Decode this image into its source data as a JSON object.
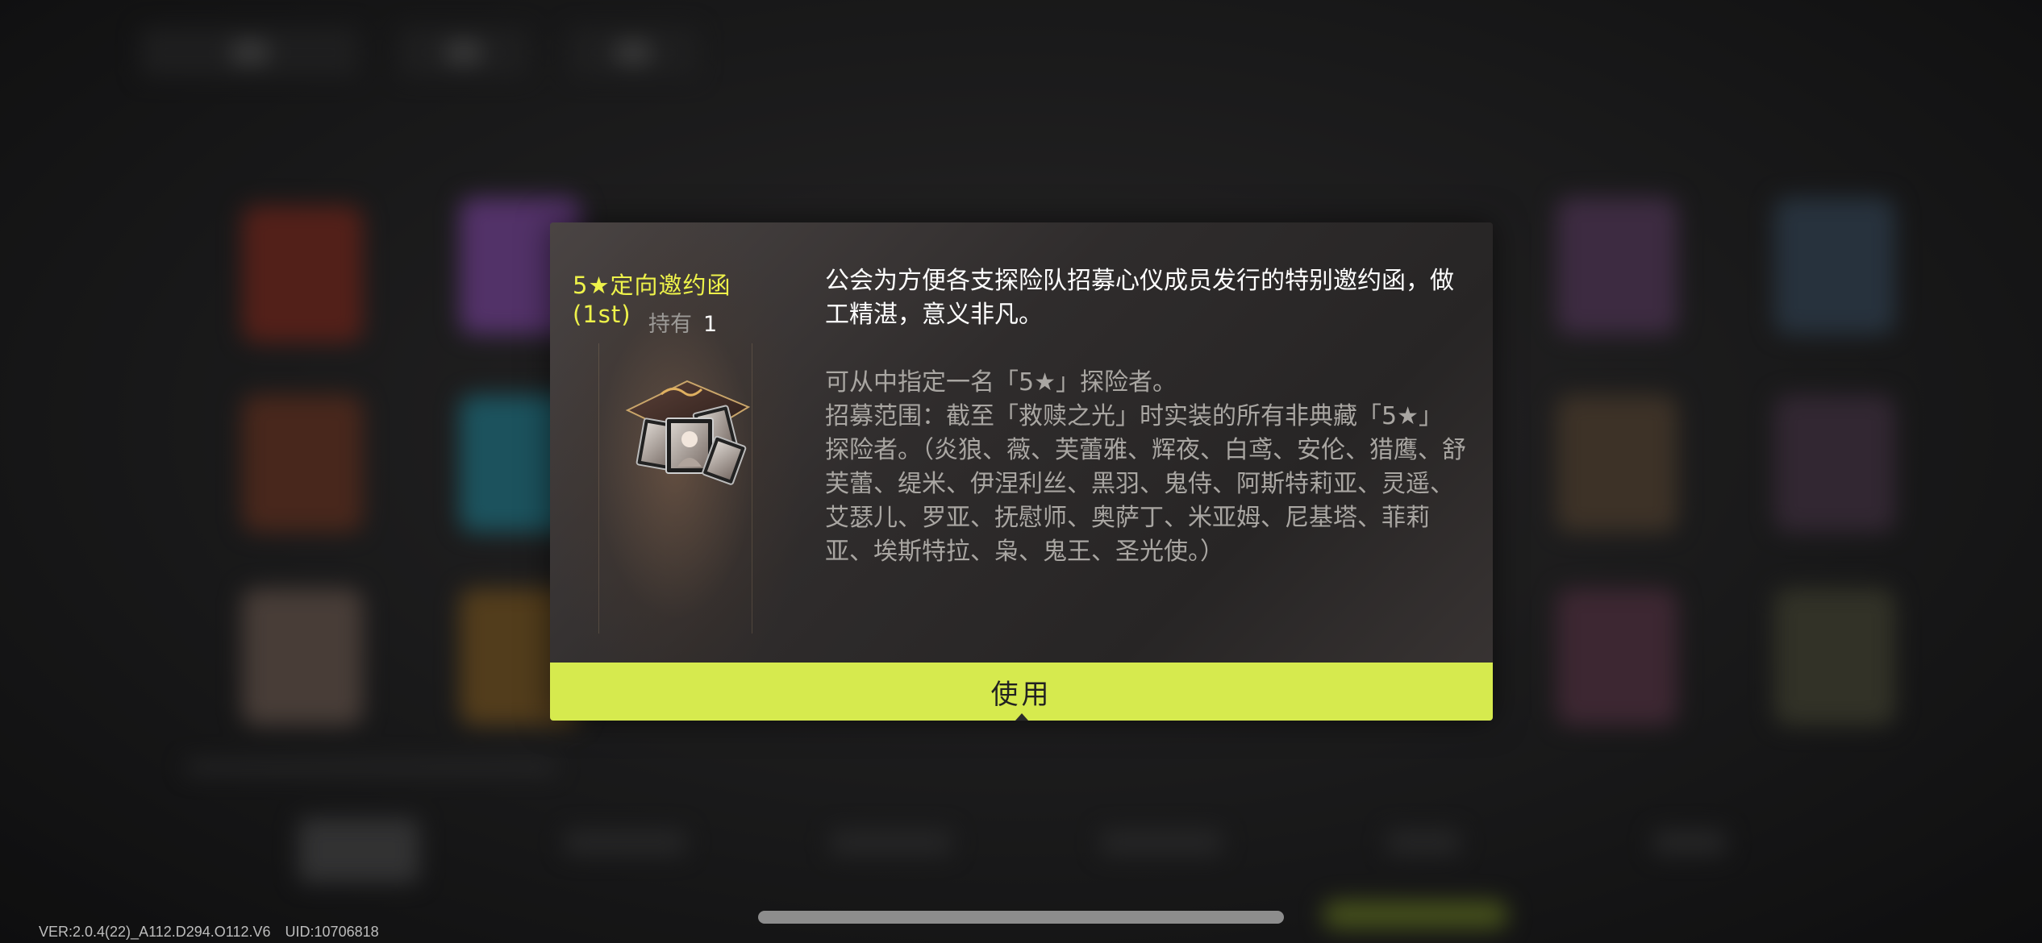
{
  "dialog": {
    "item_name": "5★定向邀约函(1st)",
    "owned_label": "持有",
    "owned_count": "1",
    "description": "公会为方便各支探险队招募心仪成员发行的特别邀约函，做工精湛，意义非凡。",
    "details": "可从中指定一名「5★」探险者。\n招募范围：截至「救赎之光」时实装的所有非典藏「5★」探险者。（炎狼、薇、芙蕾雅、辉夜、白鸢、安伦、猎鹰、舒芙蕾、缇米、伊涅利丝、黑羽、鬼侍、阿斯特莉亚、灵遥、艾瑟儿、罗亚、抚慰师、奥萨丁、米亚姆、尼基塔、菲莉亚、埃斯特拉、枭、鬼王、圣光使。）",
    "use_button_label": "使用"
  },
  "footer": {
    "version": "VER:2.0.4(22)_A112.D294.O112.V6",
    "uid": "UID:10706818"
  },
  "colors": {
    "accent": "#d6ea4e",
    "item_name": "#eef24a",
    "detail_text": "#a9a6a2"
  }
}
